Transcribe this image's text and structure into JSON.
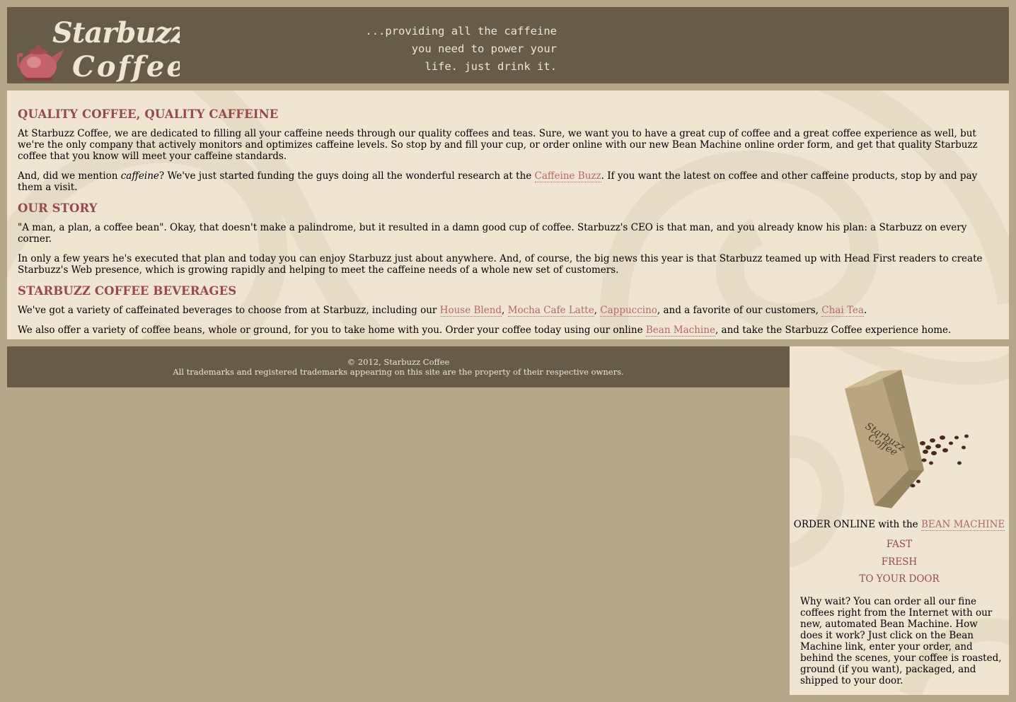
{
  "header": {
    "logo_text": "Starbuzz Coffee",
    "tagline_lines": [
      "...providing all the caffeine",
      "you need to power your",
      "life. just drink it."
    ]
  },
  "main": {
    "section1": {
      "heading": "QUALITY COFFEE, QUALITY CAFFEINE",
      "para1": "At Starbuzz Coffee, we are dedicated to filling all your caffeine needs through our quality coffees and teas. Sure, we want you to have a great cup of coffee and a great coffee experience as well, but we're the only company that actively monitors and optimizes caffeine levels. So stop by and fill your cup, or order online with our new Bean Machine online order form, and get that quality Starbuzz coffee that you know will meet your caffeine standards.",
      "para2_a": "And, did we mention ",
      "para2_em": "caffeine",
      "para2_b": "? We've just started funding the guys doing all the wonderful research at the ",
      "para2_link": "Caffeine Buzz",
      "para2_c": ". If you want the latest on coffee and other caffeine products, stop by and pay them a visit."
    },
    "section2": {
      "heading": "OUR STORY",
      "para1": "\"A man, a plan, a coffee bean\". Okay, that doesn't make a palindrome, but it resulted in a damn good cup of coffee. Starbuzz's CEO is that man, and you already know his plan: a Starbuzz on every corner.",
      "para2": "In only a few years he's executed that plan and today you can enjoy Starbuzz just about anywhere. And, of course, the big news this year is that Starbuzz teamed up with Head First readers to create Starbuzz's Web presence, which is growing rapidly and helping to meet the caffeine needs of a whole new set of customers."
    },
    "section3": {
      "heading": "STARBUZZ COFFEE BEVERAGES",
      "para1_a": "We've got a variety of caffeinated beverages to choose from at Starbuzz, including our ",
      "link_house": "House Blend",
      "sep1": ", ",
      "link_mocha": "Mocha Cafe Latte",
      "sep2": ", ",
      "link_cappuccino": "Cappuccino",
      "para1_b": ", and a favorite of our customers, ",
      "link_chai": "Chai Tea",
      "para1_c": ".",
      "para2_a": "We also offer a variety of coffee beans, whole or ground, for you to take home with you. Order your coffee today using our online ",
      "link_bean": "Bean Machine",
      "para2_b": ", and take the Starbuzz Coffee experience home."
    }
  },
  "footer": {
    "copyright": "© 2012, Starbuzz Coffee",
    "trademark": "All trademarks and registered trademarks appearing on this site are the property of their respective owners."
  },
  "sidebar": {
    "bag_label": "Starbuzz Coffee",
    "order_prefix": "ORDER ONLINE with the ",
    "order_link": "BEAN MACHINE",
    "tags": [
      "FAST",
      "FRESH",
      "TO YOUR DOOR"
    ],
    "text": "Why wait? You can order all our fine coffees right from the Internet with our new, automated Bean Machine. How does it work? Just click on the Bean Machine link, enter your order, and behind the scenes, your coffee is roasted, ground (if you want), packaged, and shipped to your door."
  },
  "colors": {
    "page_bg": "#b5a789",
    "header_bg": "#675c47",
    "content_bg": "#efe5d0",
    "heading": "#954b4b",
    "link": "#b76666"
  }
}
